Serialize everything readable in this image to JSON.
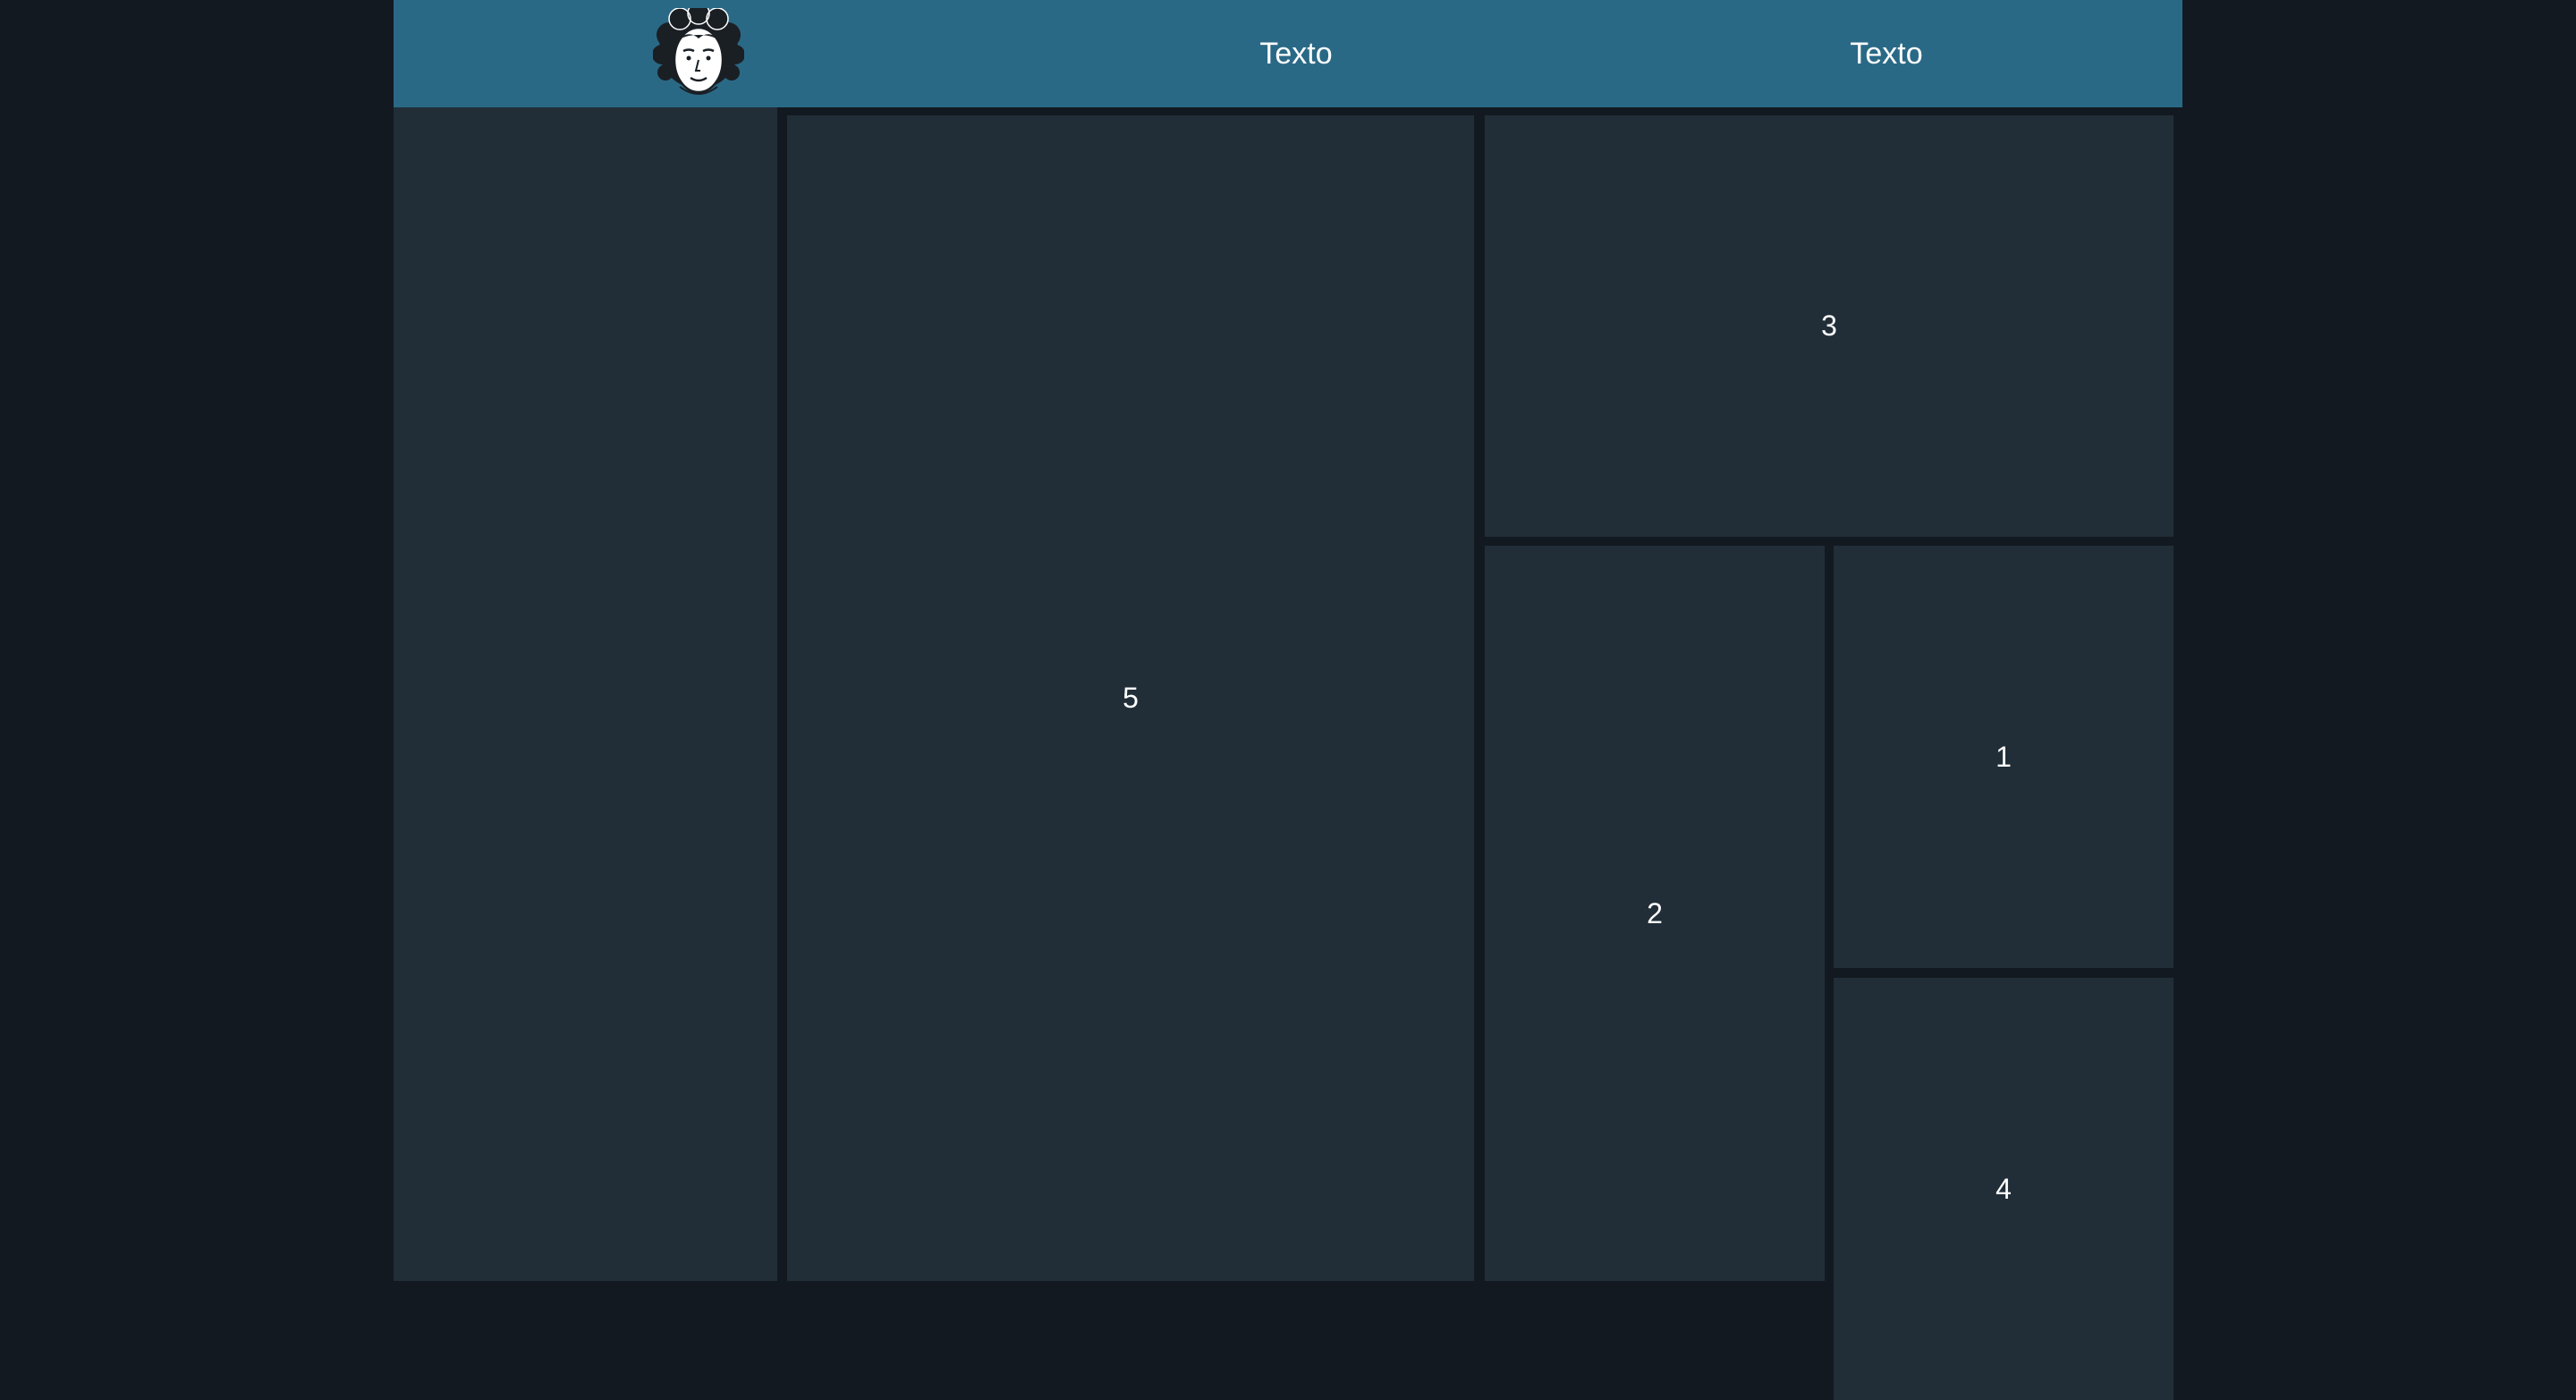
{
  "header": {
    "avatar_alt": "avatar",
    "nav": [
      {
        "label": "Texto"
      },
      {
        "label": "Texto"
      }
    ]
  },
  "grid": {
    "box5": "5",
    "box3": "3",
    "box2": "2",
    "box1": "1",
    "box4": "4"
  },
  "colors": {
    "background": "#121920",
    "header": "#2a6986",
    "panel": "#212e38",
    "text": "#ffffff"
  },
  "icons": {
    "avatar": "curly-hair-face-icon"
  }
}
